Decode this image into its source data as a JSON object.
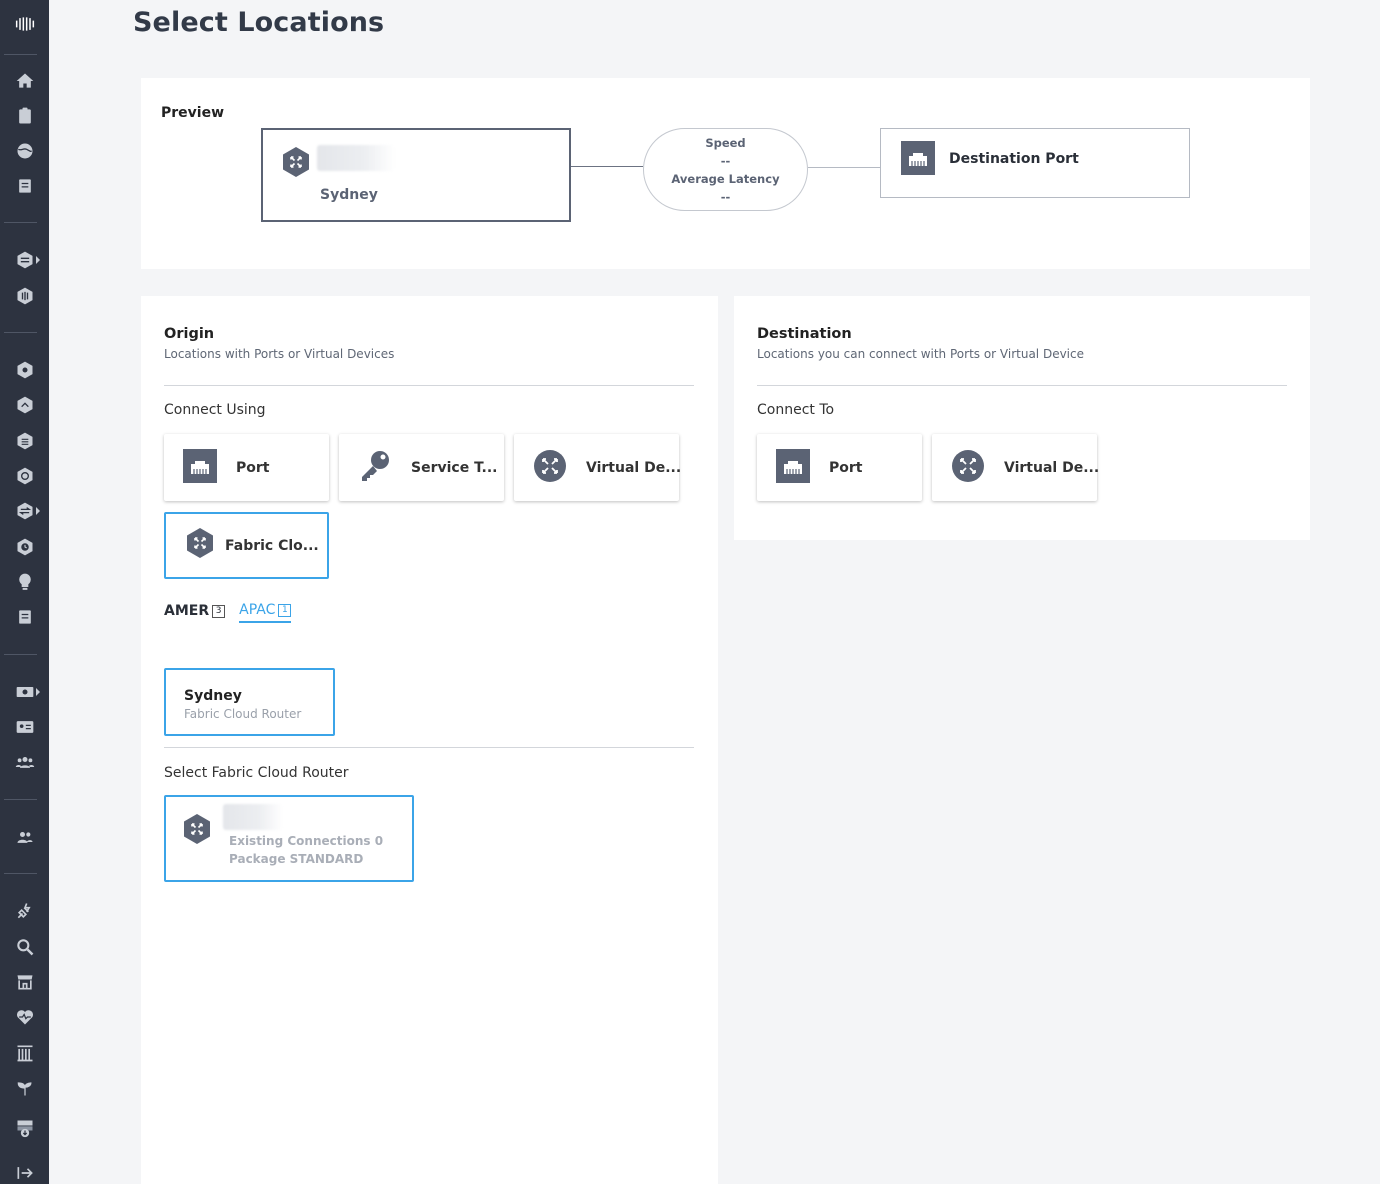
{
  "page": {
    "title": "Select Locations"
  },
  "preview": {
    "label": "Preview",
    "origin_location": "Sydney",
    "speed_label": "Speed",
    "speed_value": "--",
    "latency_label": "Average Latency",
    "latency_value": "--",
    "destination_label": "Destination Port"
  },
  "origin": {
    "title": "Origin",
    "subtitle": "Locations with Ports or Virtual Devices",
    "connect_label": "Connect Using",
    "tiles": [
      {
        "label": "Port",
        "icon": "port-icon"
      },
      {
        "label": "Service T...",
        "icon": "key-icon"
      },
      {
        "label": "Virtual De...",
        "icon": "virtual-device-icon"
      },
      {
        "label": "Fabric Clo...",
        "icon": "fabric-cloud-router-icon",
        "selected": true
      }
    ],
    "regions": [
      {
        "label": "AMER",
        "count": "3"
      },
      {
        "label": "APAC",
        "count": "1",
        "active": true
      }
    ],
    "location_card": {
      "name": "Sydney",
      "type": "Fabric Cloud Router"
    },
    "select_fcr_label": "Select Fabric Cloud Router",
    "fcr_card": {
      "connections": "Existing Connections 0",
      "package": "Package STANDARD"
    }
  },
  "destination": {
    "title": "Destination",
    "subtitle": "Locations you can connect with Ports or Virtual Device",
    "connect_label": "Connect To",
    "tiles": [
      {
        "label": "Port",
        "icon": "port-icon"
      },
      {
        "label": "Virtual De...",
        "icon": "virtual-device-icon"
      }
    ]
  },
  "colors": {
    "accent": "#3ba4e8",
    "sidebar": "#2d3340",
    "icon": "#5b6374"
  }
}
